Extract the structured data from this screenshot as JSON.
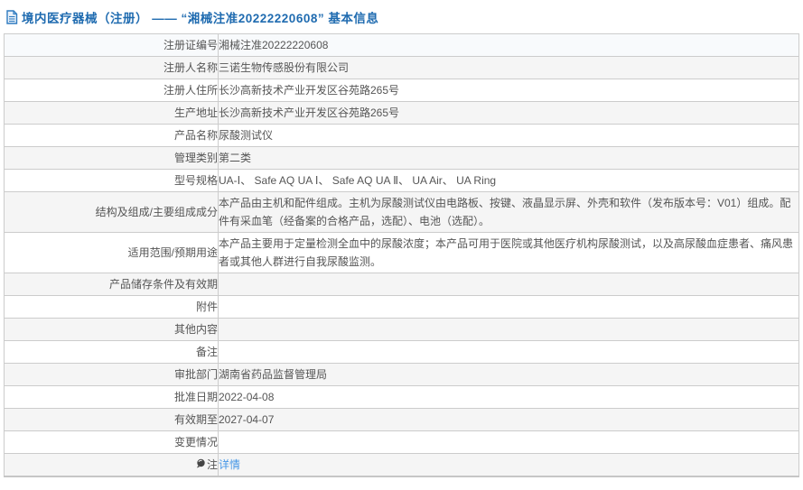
{
  "header": {
    "title": "境内医疗器械（注册） —— “湘械注准20222220608” 基本信息"
  },
  "colors": {
    "title_blue": "#1f6bb0",
    "link_blue": "#4596e6",
    "row_stripe": "#f5f5f5",
    "first_row_tint": "#f8fafc",
    "border_gray": "#cccccc",
    "text_gray": "#555555"
  },
  "icons": {
    "header_icon": "document-icon",
    "note_row_icon": "note-bulb-icon"
  },
  "table": {
    "rows": [
      {
        "label": "注册证编号",
        "value": "湘械注准20222220608"
      },
      {
        "label": "注册人名称",
        "value": "三诺生物传感股份有限公司"
      },
      {
        "label": "注册人住所",
        "value": "长沙高新技术产业开发区谷苑路265号"
      },
      {
        "label": "生产地址",
        "value": "长沙高新技术产业开发区谷苑路265号"
      },
      {
        "label": "产品名称",
        "value": "尿酸测试仪"
      },
      {
        "label": "管理类别",
        "value": "第二类"
      },
      {
        "label": "型号规格",
        "value": "UA-Ⅰ、 Safe AQ UA Ⅰ、 Safe AQ UA Ⅱ、 UA Air、 UA Ring"
      },
      {
        "label": "结构及组成/主要组成成分",
        "value": "本产品由主机和配件组成。主机为尿酸测试仪由电路板、按键、液晶显示屏、外壳和软件（发布版本号：V01）组成。配件有采血笔（经备案的合格产品，选配）、电池（选配）。"
      },
      {
        "label": "适用范围/预期用途",
        "value": "本产品主要用于定量检测全血中的尿酸浓度；本产品可用于医院或其他医疗机构尿酸测试，以及高尿酸血症患者、痛风患者或其他人群进行自我尿酸监测。"
      },
      {
        "label": "产品储存条件及有效期",
        "value": ""
      },
      {
        "label": "附件",
        "value": ""
      },
      {
        "label": "其他内容",
        "value": ""
      },
      {
        "label": "备注",
        "value": ""
      },
      {
        "label": "审批部门",
        "value": "湖南省药品监督管理局"
      },
      {
        "label": "批准日期",
        "value": "2022-04-08"
      },
      {
        "label": "有效期至",
        "value": "2027-04-07"
      },
      {
        "label": "变更情况",
        "value": ""
      },
      {
        "label": "注",
        "value_link": "详情"
      }
    ]
  }
}
